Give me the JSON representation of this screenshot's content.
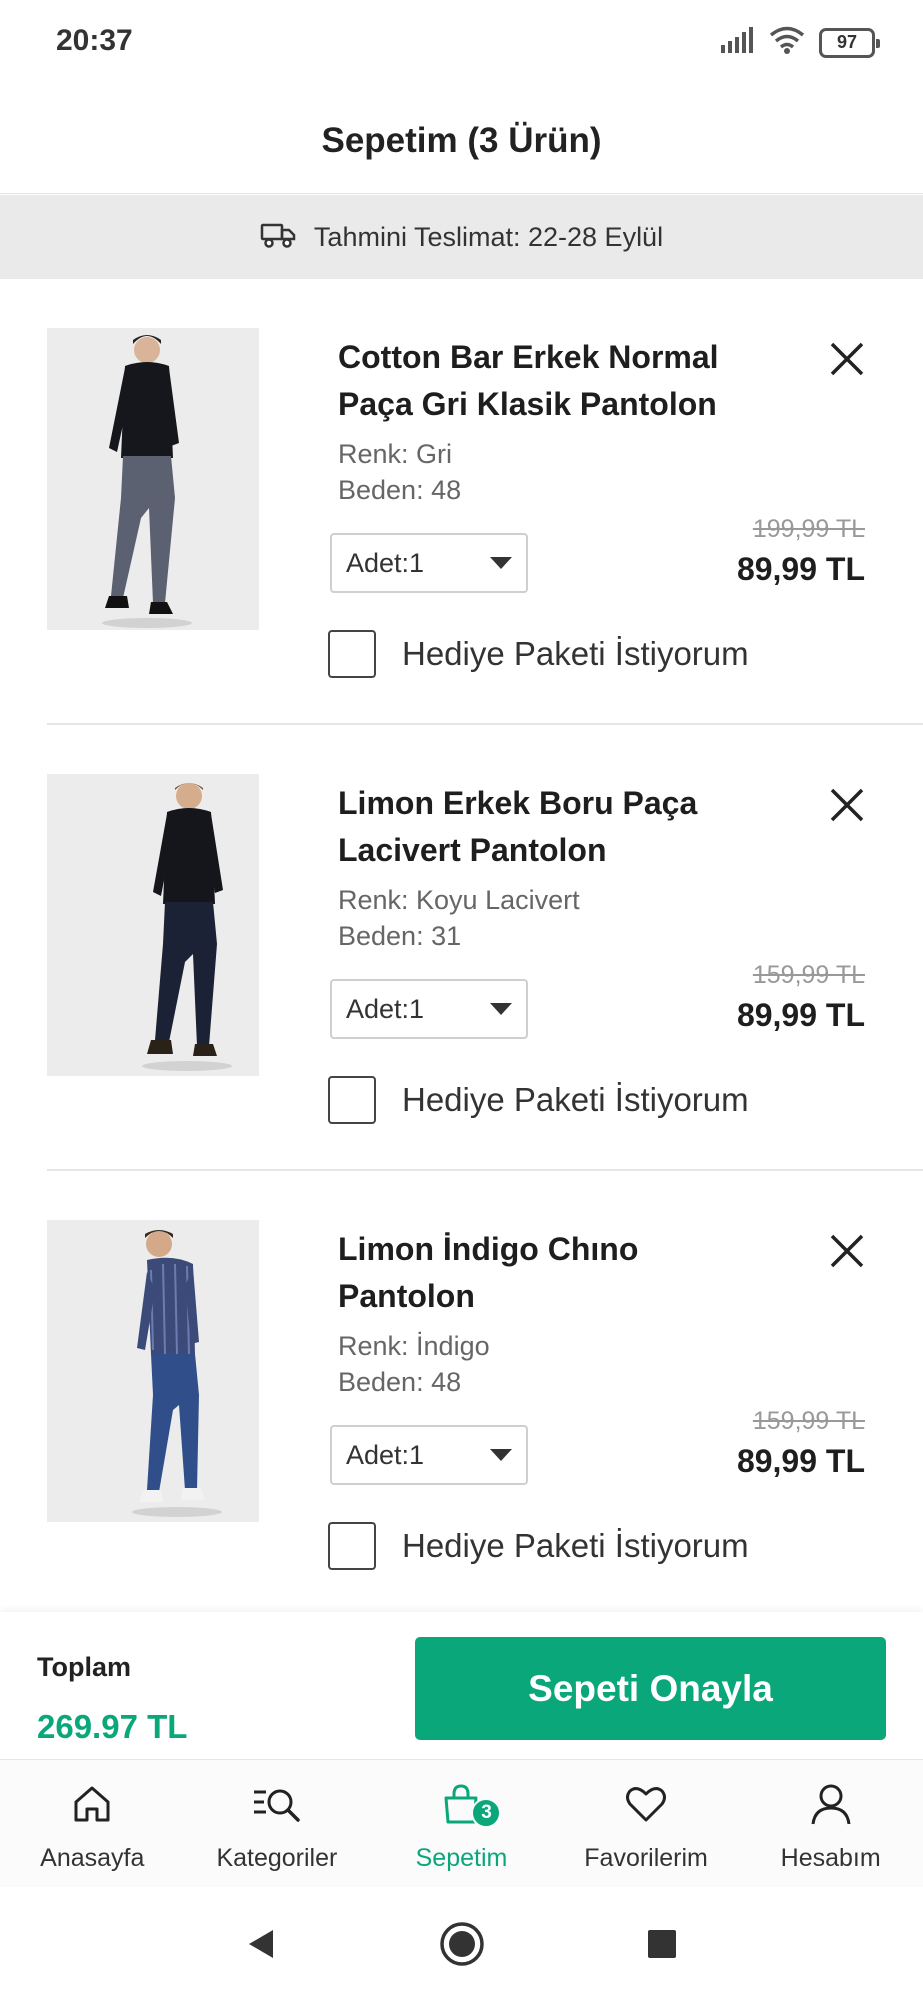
{
  "status_bar": {
    "time": "20:37",
    "battery": "97"
  },
  "header": {
    "title": "Sepetim (3 Ürün)"
  },
  "delivery": {
    "text": "Tahmini Teslimat: 22-28 Eylül"
  },
  "cart": {
    "items": [
      {
        "name": "Cotton Bar Erkek Normal Paça Gri Klasik Pantolon",
        "color": "Renk: Gri",
        "size": "Beden: 48",
        "quantity": "Adet:1",
        "old_price": "199,99 TL",
        "price": "89,99 TL",
        "gift_label": "Hediye Paketi İstiyorum"
      },
      {
        "name": "Limon Erkek Boru Paça Lacivert Pantolon",
        "color": "Renk: Koyu Lacivert",
        "size": "Beden: 31",
        "quantity": "Adet:1",
        "old_price": "159,99 TL",
        "price": "89,99 TL",
        "gift_label": "Hediye Paketi İstiyorum"
      },
      {
        "name": "Limon İndigo Chıno Pantolon",
        "color": "Renk: İndigo",
        "size": "Beden: 48",
        "quantity": "Adet:1",
        "old_price": "159,99 TL",
        "price": "89,99 TL",
        "gift_label": "Hediye Paketi İstiyorum"
      }
    ]
  },
  "summary": {
    "total_label": "Toplam",
    "total_value": "269.97 TL",
    "confirm_label": "Sepeti Onayla"
  },
  "bottom_nav": {
    "items": [
      {
        "label": "Anasayfa",
        "icon": "home-icon"
      },
      {
        "label": "Kategoriler",
        "icon": "categories-search-icon"
      },
      {
        "label": "Sepetim",
        "icon": "shopping-bag-icon",
        "badge": "3",
        "active": true
      },
      {
        "label": "Favorilerim",
        "icon": "heart-icon"
      },
      {
        "label": "Hesabım",
        "icon": "user-icon"
      }
    ]
  },
  "colors": {
    "accent": "#0aa77a",
    "delivery_bg": "#eaeaea"
  }
}
